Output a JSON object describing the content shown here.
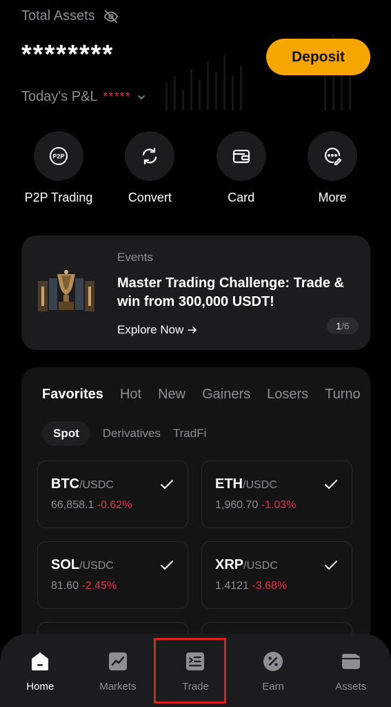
{
  "header": {
    "assets_label": "Total Assets",
    "balance_masked": "********",
    "deposit_label": "Deposit",
    "pnl_label": "Today's P&L",
    "pnl_masked": "*****"
  },
  "actions": [
    {
      "label": "P2P Trading",
      "icon": "p2p-icon"
    },
    {
      "label": "Convert",
      "icon": "convert-icon"
    },
    {
      "label": "Card",
      "icon": "card-icon"
    },
    {
      "label": "More",
      "icon": "more-icon"
    }
  ],
  "events": {
    "tag": "Events",
    "title": "Master Trading Challenge: Trade & win from 300,000 USDT!",
    "link": "Explore Now",
    "pager_current": "1",
    "pager_total": "/6"
  },
  "market": {
    "tabs": [
      "Favorites",
      "Hot",
      "New",
      "Gainers",
      "Losers",
      "Turno"
    ],
    "sub_tabs": [
      "Spot",
      "Derivatives",
      "TradFi"
    ],
    "pairs": [
      {
        "base": "BTC",
        "quote": "/USDC",
        "price": "66,858.1",
        "change": "-0.62%"
      },
      {
        "base": "ETH",
        "quote": "/USDC",
        "price": "1,960.70",
        "change": "-1.03%"
      },
      {
        "base": "SOL",
        "quote": "/USDC",
        "price": "81.60",
        "change": "-2.45%"
      },
      {
        "base": "XRP",
        "quote": "/USDC",
        "price": "1.4121",
        "change": "-3.68%"
      }
    ]
  },
  "nav": [
    {
      "label": "Home",
      "icon": "home-icon",
      "active": true
    },
    {
      "label": "Markets",
      "icon": "markets-icon",
      "active": false
    },
    {
      "label": "Trade",
      "icon": "trade-icon",
      "active": false
    },
    {
      "label": "Earn",
      "icon": "earn-icon",
      "active": false
    },
    {
      "label": "Assets",
      "icon": "wallet-icon",
      "active": false
    }
  ],
  "colors": {
    "accent": "#f7a600",
    "negative": "#e5304a",
    "highlight": "#e0201a"
  }
}
